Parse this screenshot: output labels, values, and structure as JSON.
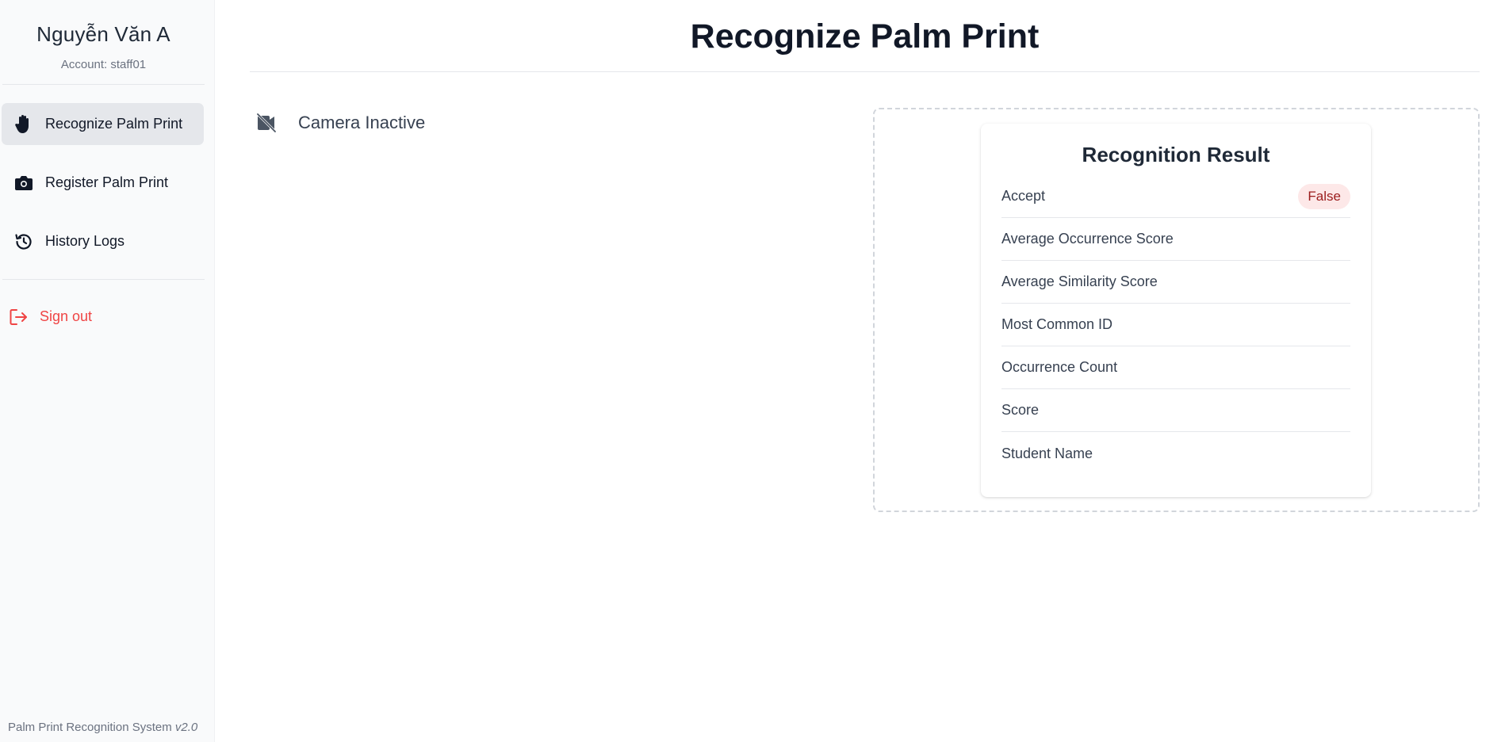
{
  "sidebar": {
    "user_name": "Nguyễn Văn A",
    "account_label": "Account: staff01",
    "items": [
      {
        "label": "Recognize Palm Print",
        "icon": "hand-icon",
        "active": true
      },
      {
        "label": "Register Palm Print",
        "icon": "camera-icon",
        "active": false
      },
      {
        "label": "History Logs",
        "icon": "history-icon",
        "active": false
      }
    ],
    "signout_label": "Sign out",
    "footer_text": "Palm Print Recognition System",
    "footer_version": "v2.0"
  },
  "main": {
    "title": "Recognize Palm Print",
    "camera_status": "Camera Inactive",
    "result": {
      "title": "Recognition Result",
      "rows": [
        {
          "label": "Accept",
          "value": "False"
        },
        {
          "label": "Average Occurrence Score",
          "value": ""
        },
        {
          "label": "Average Similarity Score",
          "value": ""
        },
        {
          "label": "Most Common ID",
          "value": ""
        },
        {
          "label": "Occurrence Count",
          "value": ""
        },
        {
          "label": "Score",
          "value": ""
        },
        {
          "label": "Student Name",
          "value": ""
        }
      ]
    }
  },
  "colors": {
    "accent_danger": "#ef4444",
    "badge_bg": "#fde8e8",
    "badge_text": "#9b1c1c",
    "sidebar_bg": "#f9fafb",
    "active_item_bg": "#e5e7eb"
  }
}
